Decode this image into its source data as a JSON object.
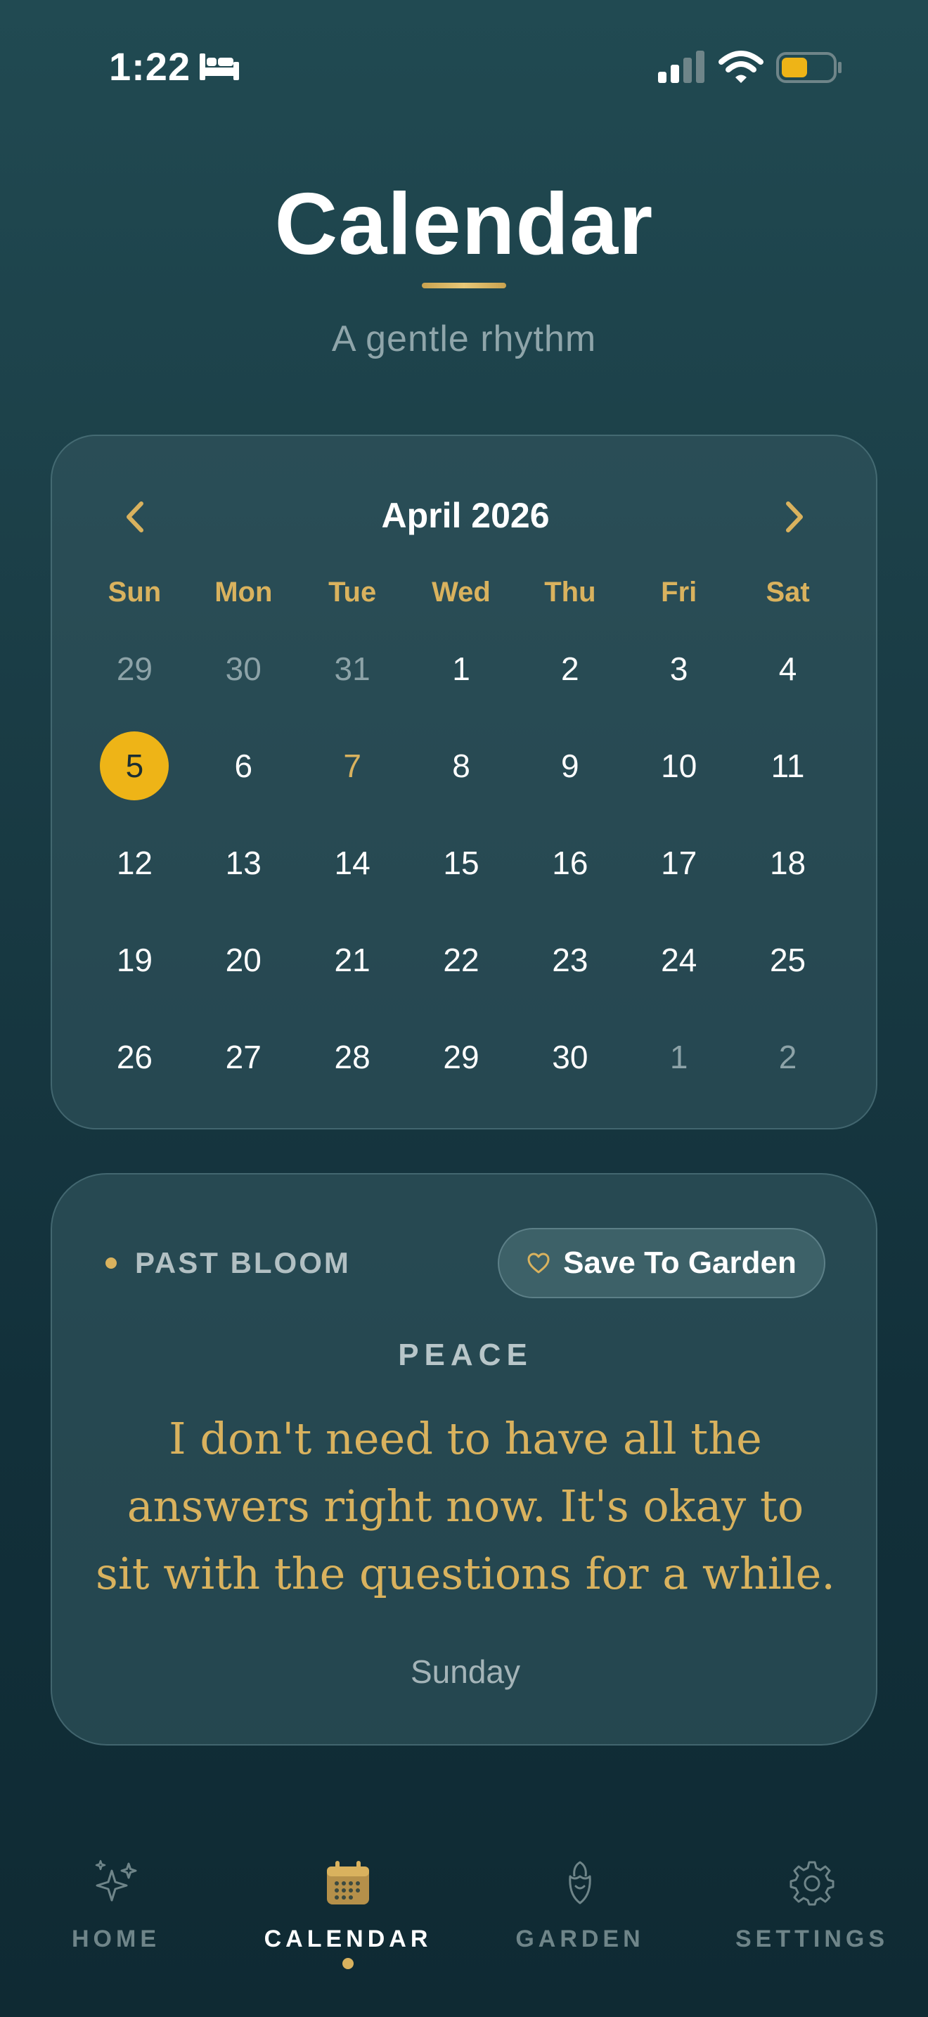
{
  "status_bar": {
    "time": "1:22"
  },
  "header": {
    "title": "Calendar",
    "subtitle": "A gentle rhythm"
  },
  "calendar": {
    "month_label": "April 2026",
    "weekdays": [
      "Sun",
      "Mon",
      "Tue",
      "Wed",
      "Thu",
      "Fri",
      "Sat"
    ],
    "days": [
      {
        "label": "29",
        "state": "muted"
      },
      {
        "label": "30",
        "state": "muted"
      },
      {
        "label": "31",
        "state": "muted"
      },
      {
        "label": "1",
        "state": "normal"
      },
      {
        "label": "2",
        "state": "normal"
      },
      {
        "label": "3",
        "state": "normal"
      },
      {
        "label": "4",
        "state": "normal"
      },
      {
        "label": "5",
        "state": "today"
      },
      {
        "label": "6",
        "state": "normal"
      },
      {
        "label": "7",
        "state": "accent"
      },
      {
        "label": "8",
        "state": "normal"
      },
      {
        "label": "9",
        "state": "normal"
      },
      {
        "label": "10",
        "state": "normal"
      },
      {
        "label": "11",
        "state": "normal"
      },
      {
        "label": "12",
        "state": "normal"
      },
      {
        "label": "13",
        "state": "normal"
      },
      {
        "label": "14",
        "state": "normal"
      },
      {
        "label": "15",
        "state": "normal"
      },
      {
        "label": "16",
        "state": "normal"
      },
      {
        "label": "17",
        "state": "normal"
      },
      {
        "label": "18",
        "state": "normal"
      },
      {
        "label": "19",
        "state": "normal"
      },
      {
        "label": "20",
        "state": "normal"
      },
      {
        "label": "21",
        "state": "normal"
      },
      {
        "label": "22",
        "state": "normal"
      },
      {
        "label": "23",
        "state": "normal"
      },
      {
        "label": "24",
        "state": "normal"
      },
      {
        "label": "25",
        "state": "normal"
      },
      {
        "label": "26",
        "state": "normal"
      },
      {
        "label": "27",
        "state": "normal"
      },
      {
        "label": "28",
        "state": "normal"
      },
      {
        "label": "29",
        "state": "normal"
      },
      {
        "label": "30",
        "state": "normal"
      },
      {
        "label": "1",
        "state": "muted"
      },
      {
        "label": "2",
        "state": "muted"
      }
    ],
    "prev_icon": "chevron-left-icon",
    "next_icon": "chevron-right-icon"
  },
  "bloom": {
    "label": "PAST BLOOM",
    "save_label": "Save To Garden",
    "save_icon": "heart-icon",
    "emotion": "PEACE",
    "quote": "I don't need to have all the answers right now. It's okay to sit with the questions for a while.",
    "day": "Sunday"
  },
  "nav": {
    "items": [
      {
        "label": "HOME",
        "icon": "sparkles-icon"
      },
      {
        "label": "CALENDAR",
        "icon": "calendar-icon",
        "active": true
      },
      {
        "label": "GARDEN",
        "icon": "rose-icon"
      },
      {
        "label": "SETTINGS",
        "icon": "gear-icon"
      }
    ]
  },
  "colors": {
    "accent_gold": "#d9b25e",
    "today_fill": "#eeb417",
    "background_top": "#214a52",
    "background_bottom": "#0f2a33"
  }
}
